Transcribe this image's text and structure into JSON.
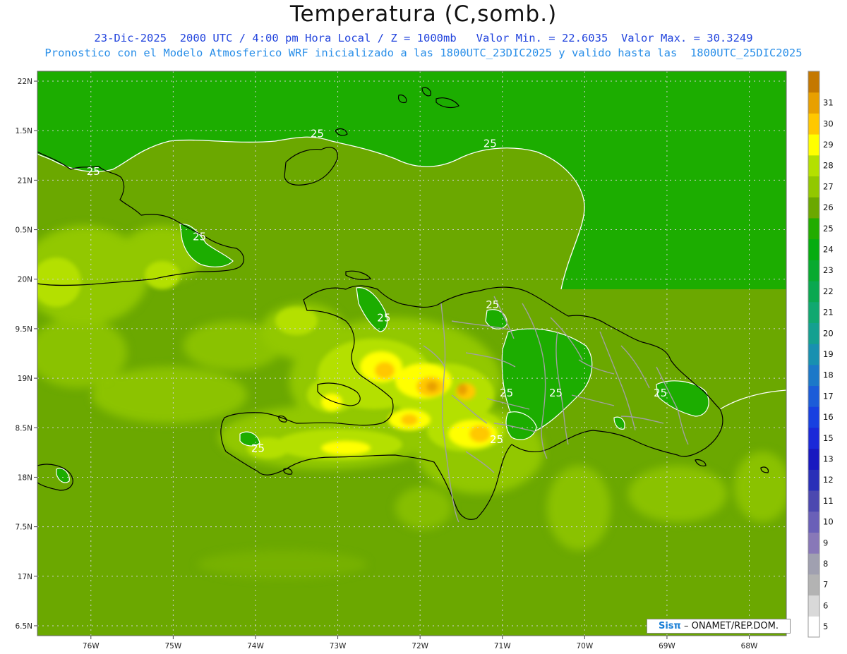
{
  "header": {
    "title": "Temperatura (C,somb.)",
    "subtitle_1": "23-Dic-2025  2000 UTC / 4:00 pm Hora Local / Z = 1000mb   Valor Min. = 22.6035  Valor Max. = 30.3249",
    "subtitle_2": "Pronostico con el Modelo Atmosferico WRF inicializado a las 1800UTC_23DIC2025 y valido hasta las  1800UTC_25DIC2025"
  },
  "map": {
    "longitudes": [
      {
        "value": -76,
        "label": "76W"
      },
      {
        "value": -75,
        "label": "75W"
      },
      {
        "value": -74,
        "label": "74W"
      },
      {
        "value": -73,
        "label": "73W"
      },
      {
        "value": -72,
        "label": "72W"
      },
      {
        "value": -71,
        "label": "71W"
      },
      {
        "value": -70,
        "label": "70W"
      },
      {
        "value": -69,
        "label": "69W"
      },
      {
        "value": -68,
        "label": "68W"
      }
    ],
    "latitudes": [
      {
        "value": 22,
        "label": "22N"
      },
      {
        "value": 21.5,
        "label": "1.5N"
      },
      {
        "value": 21,
        "label": "21N"
      },
      {
        "value": 20.5,
        "label": "0.5N"
      },
      {
        "value": 20,
        "label": "20N"
      },
      {
        "value": 19.5,
        "label": "9.5N"
      },
      {
        "value": 19,
        "label": "19N"
      },
      {
        "value": 18.5,
        "label": "8.5N"
      },
      {
        "value": 18,
        "label": "18N"
      },
      {
        "value": 17.5,
        "label": "7.5N"
      },
      {
        "value": 17,
        "label": "17N"
      },
      {
        "value": 16.5,
        "label": "6.5N"
      }
    ],
    "contour_labels": [
      {
        "text": "25",
        "lon": -73.25,
        "lat": 21.47
      },
      {
        "text": "25",
        "lon": -71.15,
        "lat": 21.37
      },
      {
        "text": "25",
        "lon": -75.97,
        "lat": 21.09
      },
      {
        "text": "25",
        "lon": -74.68,
        "lat": 20.43
      },
      {
        "text": "25",
        "lon": -72.44,
        "lat": 19.61
      },
      {
        "text": "25",
        "lon": -71.12,
        "lat": 19.74
      },
      {
        "text": "25",
        "lon": -70.95,
        "lat": 18.85
      },
      {
        "text": "25",
        "lon": -70.35,
        "lat": 18.85
      },
      {
        "text": "25",
        "lon": -69.08,
        "lat": 18.85
      },
      {
        "text": "25",
        "lon": -73.97,
        "lat": 18.29
      },
      {
        "text": "25",
        "lon": -71.07,
        "lat": 18.38
      }
    ],
    "fill_color": "#6ba800",
    "ocean_cool_color": "#1cad00",
    "warm_color": "#ffd000"
  },
  "colorbar": {
    "levels": [
      "5",
      "6",
      "7",
      "8",
      "9",
      "10",
      "11",
      "12",
      "13",
      "15",
      "16",
      "17",
      "18",
      "19",
      "20",
      "21",
      "22",
      "23",
      "24",
      "25",
      "26",
      "27",
      "28",
      "29",
      "30",
      "31"
    ],
    "colors": [
      "#ffffff",
      "#d9d9d9",
      "#b3b3b3",
      "#a0a0b0",
      "#8878b8",
      "#6a60b8",
      "#4c48b0",
      "#2a30b8",
      "#1818c0",
      "#1a28d8",
      "#1840e0",
      "#1c5cd8",
      "#1c78c8",
      "#1890b0",
      "#14a090",
      "#10a870",
      "#0aa850",
      "#08aa30",
      "#06ac10",
      "#22ac00",
      "#6ba800",
      "#92c800",
      "#b4e000",
      "#ffff00",
      "#ffc800",
      "#e8a000",
      "#c47800"
    ]
  },
  "credit": {
    "brand": "SisPi",
    "text": "– ONAMET/REP.DOM."
  }
}
